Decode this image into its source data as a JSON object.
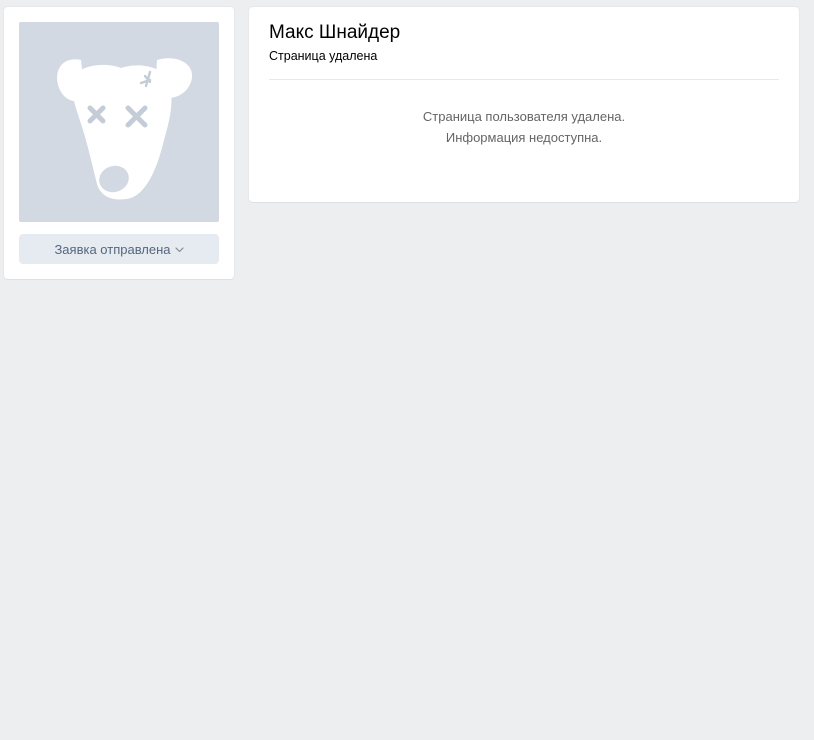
{
  "profile": {
    "name": "Макс Шнайдер",
    "status": "Страница удалена",
    "deleted_line1": "Страница пользователя удалена.",
    "deleted_line2": "Информация недоступна."
  },
  "actions": {
    "request_label": "Заявка отправлена"
  },
  "avatar": {
    "icon": "deleted-dog-icon",
    "background": "#d3d9e2"
  },
  "colors": {
    "page_bg": "#edeef0",
    "card_bg": "#ffffff",
    "button_bg": "#e5ebf1",
    "button_text": "#55677d",
    "info_text": "#656565"
  }
}
